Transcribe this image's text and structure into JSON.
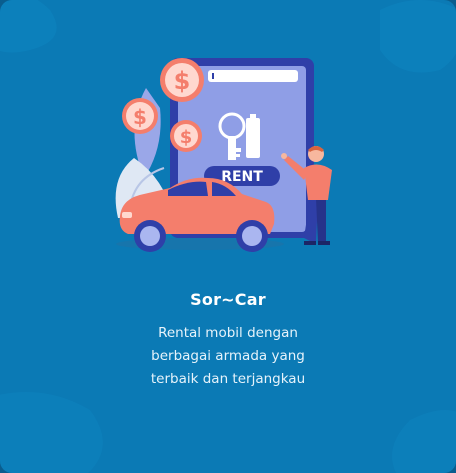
{
  "card": {
    "title": "Sor~Car",
    "description_lines": [
      "Rental mobil dengan",
      "berbagai armada yang",
      "terbaik dan terjangkau"
    ],
    "illustration": {
      "sign_text": "RENT",
      "coin_symbol": "$",
      "icons": [
        "phone-screen",
        "key-icon",
        "dollar-coin-icon",
        "car-icon",
        "person-pointing"
      ]
    }
  },
  "colors": {
    "card_background": "#0b7ab5",
    "accent_coral": "#f47e6c",
    "accent_blue": "#2f3fa8",
    "text": "#ffffff"
  }
}
